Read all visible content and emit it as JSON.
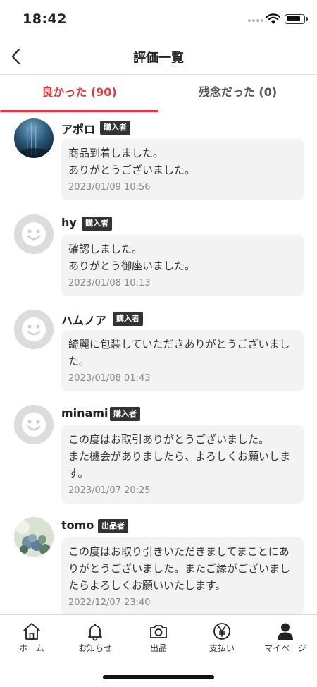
{
  "status_bar": {
    "time": "18:42",
    "battery_level": 0.85
  },
  "nav": {
    "title": "評価一覧",
    "back_icon": "chevron-left-icon"
  },
  "tabs": [
    {
      "label": "良かった (90)",
      "active": true
    },
    {
      "label": "残念だった (0)",
      "active": false
    }
  ],
  "reviews": [
    {
      "name": "アポロ",
      "role": "購入者",
      "avatar": "photo-underwater",
      "text": "商品到着しました。\nありがとうございました。",
      "date": "2023/01/09 10:56"
    },
    {
      "name": "hy",
      "role": "購入者",
      "avatar": "default",
      "text": "確認しました。\nありがとう御座いました。",
      "date": "2023/01/08 10:13"
    },
    {
      "name": "ハムノア",
      "role": "購入者",
      "avatar": "default",
      "text": "綺麗に包装していただきありがとうございました。",
      "date": "2023/01/08 01:43"
    },
    {
      "name": "minami",
      "role": "購入者",
      "avatar": "default",
      "text": "この度はお取引ありがとうございました。\nまた機会がありましたら、よろしくお願いします。",
      "date": "2023/01/07 20:25"
    },
    {
      "name": "tomo",
      "role": "出品者",
      "avatar": "photo-flowers",
      "text": "この度はお取り引きいただきましてまことにありがとうございました。またご縁がございましたらよろしくお願いいたします。",
      "date": "2022/12/07 23:40"
    }
  ],
  "tabbar": [
    {
      "label": "ホーム",
      "icon": "home-icon"
    },
    {
      "label": "お知らせ",
      "icon": "bell-icon"
    },
    {
      "label": "出品",
      "icon": "camera-icon"
    },
    {
      "label": "支払い",
      "icon": "yen-icon"
    },
    {
      "label": "マイページ",
      "icon": "person-icon"
    }
  ],
  "colors": {
    "accent": "#e03a3e",
    "badge_bg": "#333333",
    "bubble_bg": "#f3f3f3"
  }
}
